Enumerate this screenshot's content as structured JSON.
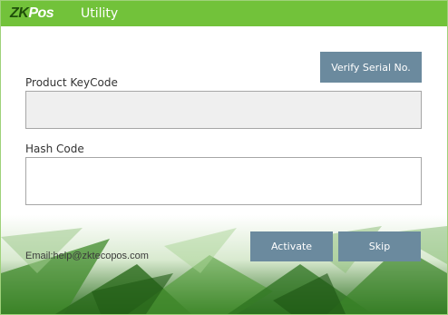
{
  "window": {
    "brand_zk": "ZK",
    "brand_pos": "Pos",
    "title": "Utility"
  },
  "form": {
    "verify_button": "Verify Serial No.",
    "product_keycode_label": "Product KeyCode",
    "product_keycode_value": "",
    "hash_code_label": "Hash Code",
    "hash_code_value": ""
  },
  "footer": {
    "email": "Email:help@zktecopos.com",
    "activate_button": "Activate",
    "skip_button": "Skip"
  },
  "colors": {
    "titlebar": "#72c23a",
    "button": "#6b8a9e",
    "footer_green": "#2e7d1e"
  }
}
